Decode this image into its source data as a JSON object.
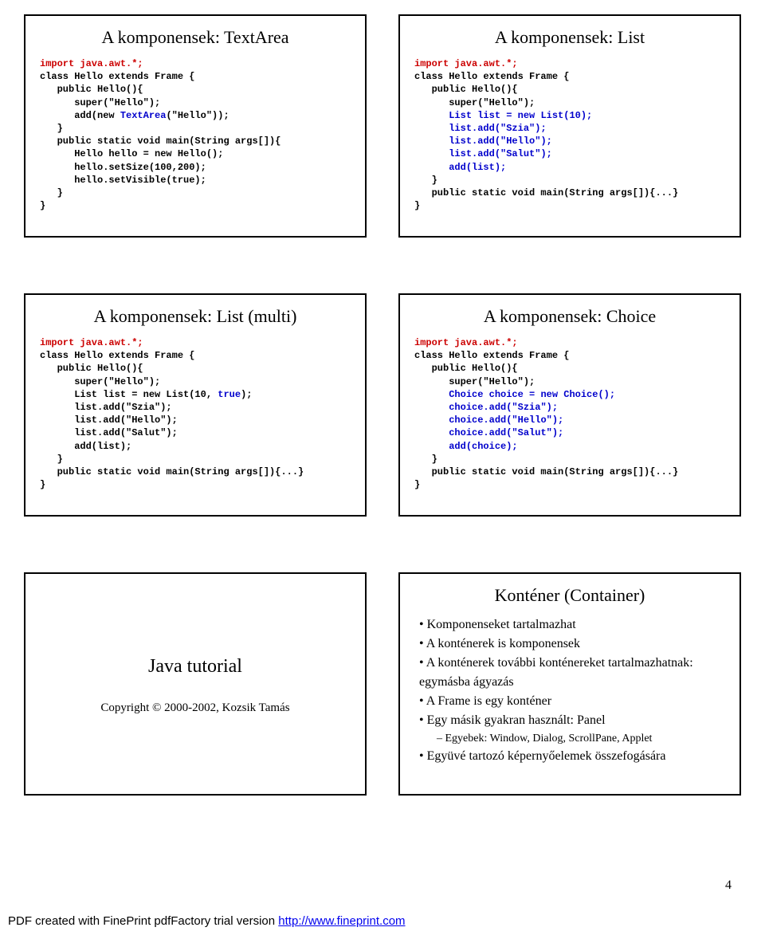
{
  "slides": {
    "s1": {
      "title": "A komponensek: TextArea",
      "code_html": "<span class='kw-red'>import java.awt.*;</span>\nclass Hello extends Frame {\n   public Hello(){\n      super(\"Hello\");\n      add(new <span class='kw-blue'>TextArea</span>(\"Hello\"));\n   }\n   public static void main(String args[]){\n      Hello hello = new Hello();\n      hello.setSize(100,200);\n      hello.setVisible(true);\n   }\n}"
    },
    "s2": {
      "title": "A komponensek: List",
      "code_html": "<span class='kw-red'>import java.awt.*;</span>\nclass Hello extends Frame {\n   public Hello(){\n      super(\"Hello\");\n      <span class='kw-blue'>List list = new List(10);</span>\n      <span class='kw-blue'>list.add(\"Szia\");</span>\n      <span class='kw-blue'>list.add(\"Hello\");</span>\n      <span class='kw-blue'>list.add(\"Salut\");</span>\n      <span class='kw-blue'>add(list);</span>\n   }\n   public static void main(String args[]){...}\n}"
    },
    "s3": {
      "title": "A komponensek: List (multi)",
      "code_html": "<span class='kw-red'>import java.awt.*;</span>\nclass Hello extends Frame {\n   public Hello(){\n      super(\"Hello\");\n      List list = new List(10, <span class='kw-blue'>true</span>);\n      list.add(\"Szia\");\n      list.add(\"Hello\");\n      list.add(\"Salut\");\n      add(list);\n   }\n   public static void main(String args[]){...}\n}"
    },
    "s4": {
      "title": "A komponensek: Choice",
      "code_html": "<span class='kw-red'>import java.awt.*;</span>\nclass Hello extends Frame {\n   public Hello(){\n      super(\"Hello\");\n      <span class='kw-blue'>Choice choice = new Choice();</span>\n      <span class='kw-blue'>choice.add(\"Szia\");</span>\n      <span class='kw-blue'>choice.add(\"Hello\");</span>\n      <span class='kw-blue'>choice.add(\"Salut\");</span>\n      <span class='kw-blue'>add(choice);</span>\n   }\n   public static void main(String args[]){...}\n}"
    },
    "s5": {
      "title": "Java tutorial",
      "subtitle": "Copyright © 2000-2002, Kozsik Tamás"
    },
    "s6": {
      "title": "Konténer (Container)",
      "bullets": [
        {
          "lvl": 1,
          "t": "Komponenseket tartalmazhat"
        },
        {
          "lvl": 1,
          "t": "A konténerek is komponensek"
        },
        {
          "lvl": 1,
          "t": "A konténerek további konténereket tartalmazhatnak: egymásba ágyazás"
        },
        {
          "lvl": 1,
          "t": "A Frame is egy konténer"
        },
        {
          "lvl": 1,
          "t": "Egy másik gyakran használt: Panel"
        },
        {
          "lvl": 2,
          "t": "Egyebek: Window, Dialog, ScrollPane, Applet"
        },
        {
          "lvl": 1,
          "t": "Együvé tartozó képernyőelemek összefogására"
        }
      ]
    }
  },
  "page_number": "4",
  "footer": {
    "prefix": "PDF created with FinePrint pdfFactory trial version ",
    "link_text": "http://www.fineprint.com"
  }
}
